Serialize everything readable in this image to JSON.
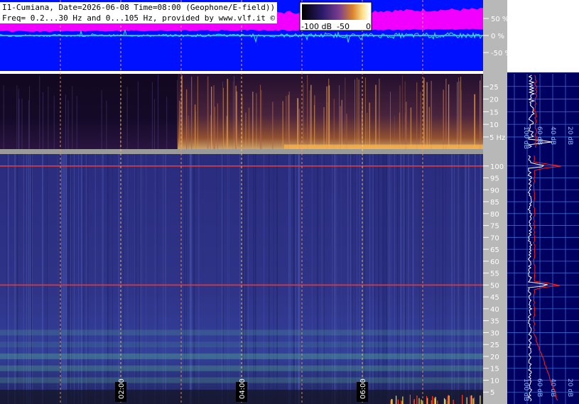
{
  "header": {
    "line1": "I1-Cumiana, Date=2026-06-08 Time=08:00 (Geophone/E-field))",
    "line2": "Freq= 0.2...30 Hz and 0...105 Hz, provided by www.vlf.it ©"
  },
  "colorbar": {
    "labels": [
      "-100 dB",
      "-50",
      "0"
    ],
    "colors": [
      "#000000",
      "#2a1a6a",
      "#7a3e8f",
      "#d9822b",
      "#ffe08a",
      "#ffffff"
    ]
  },
  "colors": {
    "waveform_bg": "#0011ff",
    "envelope": "#ff00ff",
    "trace": "#30e0ff",
    "right_panel_bg": "#000060",
    "scale_bg": "#b8b8b8",
    "line_50hz": "#ff3020",
    "spectrum_avg": "#ffffff",
    "spectrum_peak": "#ff2020"
  },
  "chart_data": [
    {
      "type": "line",
      "name": "waveform",
      "y_tick_labels": [
        "50 %",
        "0 %",
        "-50 %"
      ],
      "y_ticks": [
        50,
        0,
        -50
      ],
      "ylim": [
        -100,
        100
      ],
      "xlim": [
        0,
        8
      ],
      "time_markers": [
        1,
        2,
        3,
        4,
        5,
        6,
        7
      ]
    },
    {
      "type": "heatmap",
      "name": "spectrogram-low",
      "ylabel": "Hz",
      "y_tick_labels": [
        "25",
        "20",
        "15",
        "10",
        "5 Hz"
      ],
      "y_ticks": [
        25,
        20,
        15,
        10,
        5
      ],
      "ylim": [
        0.2,
        30
      ],
      "xlim": [
        0,
        8
      ],
      "db_range": [
        -100,
        0
      ]
    },
    {
      "type": "heatmap",
      "name": "spectrogram-high",
      "y_tick_labels": [
        "100",
        "95",
        "90",
        "85",
        "80",
        "75",
        "70",
        "65",
        "60",
        "55",
        "50",
        "45",
        "40",
        "35",
        "30",
        "25",
        "20",
        "15",
        "10",
        "5"
      ],
      "y_ticks": [
        100,
        95,
        90,
        85,
        80,
        75,
        70,
        65,
        60,
        55,
        50,
        45,
        40,
        35,
        30,
        25,
        20,
        15,
        10,
        5
      ],
      "ylim": [
        0,
        105
      ],
      "xlim": [
        0,
        8
      ],
      "x_tick_labels": [
        "02:00",
        "04:00",
        "06:00"
      ],
      "x_ticks": [
        2,
        4,
        6
      ],
      "lines_hz": [
        100,
        50
      ]
    },
    {
      "type": "line",
      "name": "spectrum-low",
      "x_tick_labels": [
        "100 dB",
        "60 dB",
        "40 dB",
        "20 dB"
      ]
    },
    {
      "type": "line",
      "name": "spectrum-high",
      "x_tick_labels": [
        "100 dB",
        "60 dB",
        "40 dB",
        "20 dB"
      ],
      "peaks_hz": [
        50,
        100
      ]
    }
  ]
}
